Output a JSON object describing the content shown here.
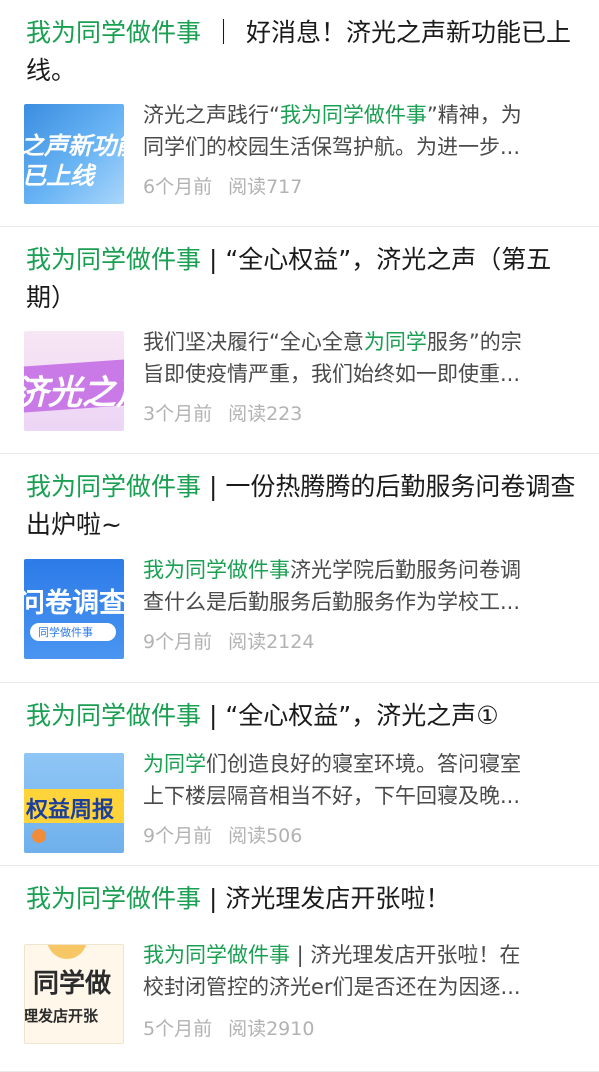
{
  "articles": [
    {
      "title_tag": "我为同学做件事",
      "title_sep": "｜",
      "title_rest": "好消息！济光之声新功能已上线。",
      "summary_hl": "我为同学做件事",
      "summary_pre": "济光之声践行“",
      "summary_post": "”精神，为",
      "summary_line2": "同学们的校园生活保驾护航。为进一步...",
      "time": "6个月前",
      "reads": "阅读717",
      "thumb_text": "之声新功能",
      "thumb_text2": "已上线",
      "thumb_icon": "promo-banner-image"
    },
    {
      "title_tag": "我为同学做件事",
      "title_sep": " | ",
      "title_rest": "“全心权益”，济光之声（第五期）",
      "summary_pre": "我们坚决履行“全心全意",
      "summary_hl": "为同学",
      "summary_post": "服务”的宗",
      "summary_line2": "旨即使疫情严重，我们始终如一即使重...",
      "time": "3个月前",
      "reads": "阅读223",
      "thumb_text": "济光之声",
      "thumb_icon": "promo-banner-image"
    },
    {
      "title_tag": "我为同学做件事",
      "title_sep": " | ",
      "title_rest": "一份热腾腾的后勤服务问卷调查出炉啦~",
      "summary_pre": "",
      "summary_hl": "我为同学做件事",
      "summary_post": "济光学院后勤服务问卷调",
      "summary_line2": "查什么是后勤服务后勤服务作为学校工...",
      "time": "9个月前",
      "reads": "阅读2124",
      "thumb_text": "问卷调查",
      "thumb_text2": "同学做件事",
      "thumb_icon": "promo-banner-image"
    },
    {
      "title_tag": "我为同学做件事",
      "title_sep": " | ",
      "title_rest": "“全心权益”，济光之声①",
      "summary_pre": "",
      "summary_hl": "为同学",
      "summary_post": "们创造良好的寝室环境。答问寝室",
      "summary_line2": "上下楼层隔音相当不好，下午回寝及晚...",
      "time": "9个月前",
      "reads": "阅读506",
      "thumb_text": "权益周报",
      "thumb_icon": "promo-banner-image"
    },
    {
      "title_tag": "我为同学做件事",
      "title_sep": " | ",
      "title_rest": "济光理发店开张啦！",
      "summary_pre": "",
      "summary_hl": "我为同学做件事",
      "summary_post": " | 济光理发店开张啦！在",
      "summary_line2": "校封闭管控的济光er们是否还在为因逐...",
      "time": "5个月前",
      "reads": "阅读2910",
      "thumb_text": "同学做",
      "thumb_text2": "理发店开张",
      "thumb_icon": "promo-banner-image"
    }
  ],
  "colors": {
    "highlight": "#1aa052",
    "text": "#1a1a1a",
    "summary": "#4a4a4a",
    "meta": "#b2b2b2",
    "divider": "#e9e9e9"
  }
}
